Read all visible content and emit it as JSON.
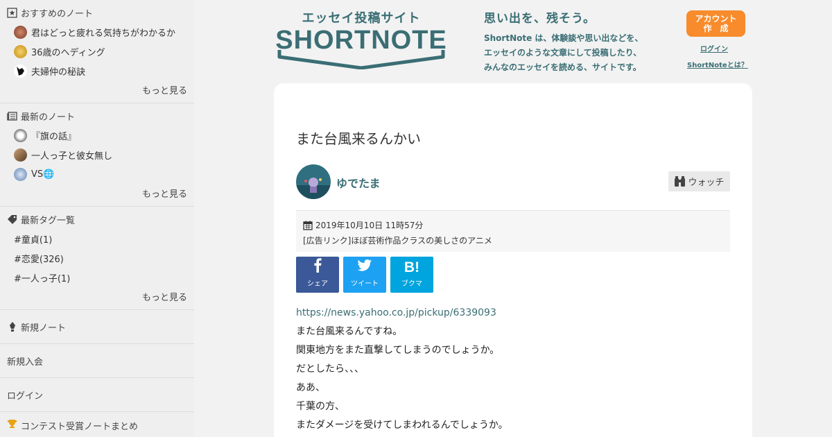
{
  "sidebar": {
    "recommended": {
      "heading": "おすすめのノート",
      "items": [
        {
          "label": "君はどっと疲れる気持ちがわかるか",
          "avatar_color": "#b0644a"
        },
        {
          "label": "36歳のヘディング",
          "avatar_color": "#e7b838"
        },
        {
          "label": "夫婦仲の秘訣",
          "avatar_color": "#222222"
        }
      ],
      "more": "もっと見る"
    },
    "latest": {
      "heading": "最新のノート",
      "items": [
        {
          "label": "『旗の話』",
          "avatar_color": "#8a8fa8"
        },
        {
          "label": "一人っ子と彼女無し",
          "avatar_color": "#a67c52"
        },
        {
          "label": "VS🌐",
          "avatar_color": "#6f8fb5"
        }
      ],
      "more": "もっと見る"
    },
    "tags": {
      "heading": "最新タグ一覧",
      "items": [
        "#童貞(1)",
        "#恋愛(326)",
        "#一人っ子(1)"
      ],
      "more": "もっと見る"
    },
    "new_note": "新規ノート",
    "signup": "新規入会",
    "login": "ログイン",
    "contest": "コンテスト受賞ノートまとめ"
  },
  "header": {
    "logo_subtitle": "エッセイ投稿サイト",
    "logo_text": "SHORTNOTE",
    "tagline_title": "思い出を、残そう。",
    "tagline_lines": [
      "ShortNote は、体験談や思い出などを、",
      "エッセイのような文章にして投稿したり、",
      "みんなのエッセイを読める、サイトです。"
    ],
    "account_button": [
      "アカウント",
      "作　成"
    ],
    "login_link": "ログイン",
    "about_link": "ShortNoteとは？"
  },
  "post": {
    "title": "また台風来るんかい",
    "author": "ゆでたま",
    "watch_label": "ウォッチ",
    "date": "2019年10月10日 11時57分",
    "ad": "[広告リンク]ほぼ芸術作品クラスの美しさのアニメ",
    "share": [
      {
        "label": "シェア",
        "glyph": "f",
        "color": "#3b5998"
      },
      {
        "label": "ツイート",
        "glyph": "🐦",
        "color": "#1da1f2"
      },
      {
        "label": "ブクマ",
        "glyph": "B!",
        "color": "#00a4de"
      }
    ],
    "link": "https://news.yahoo.co.jp/pickup/6339093",
    "lines": [
      "また台風来るんですね。",
      "関東地方をまた直撃してしまうのでしょうか。",
      "だとしたら、、、",
      "ああ、",
      "千葉の方、",
      "またダメージを受けてしまわれるんでしょうか。"
    ]
  },
  "colors": {
    "brand": "#3a6e74",
    "accent": "#f88b2b"
  }
}
